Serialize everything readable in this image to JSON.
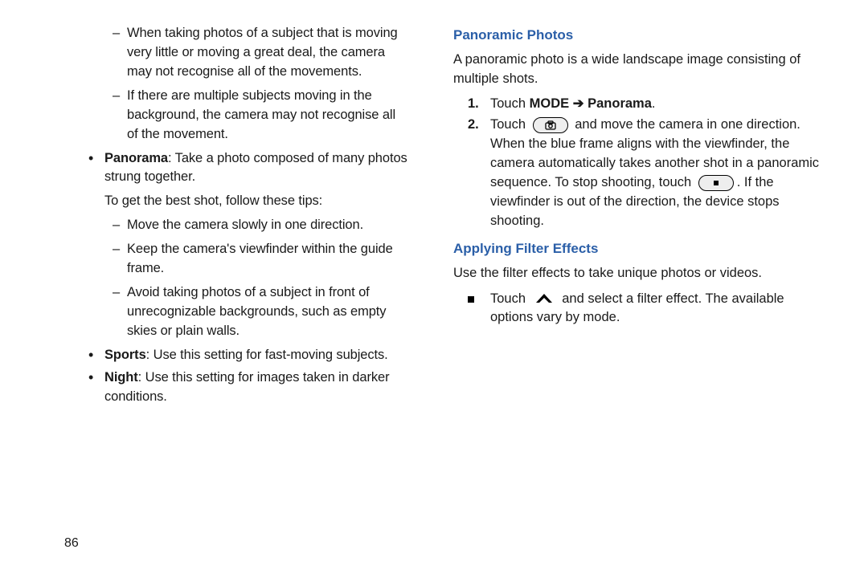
{
  "left": {
    "dash1": "When taking photos of a subject that is moving very little or moving a great deal, the camera may not recognise all of the movements.",
    "dash2": "If there are multiple subjects moving in the background, the camera may not recognise all of the movement.",
    "panorama_label": "Panorama",
    "panorama_text": ": Take a photo composed of many photos strung together.",
    "best_shot": "To get the best shot, follow these tips:",
    "tip1": "Move the camera slowly in one direction.",
    "tip2": "Keep the camera's viewfinder within the guide frame.",
    "tip3": "Avoid taking photos of a subject in front of unrecognizable backgrounds, such as empty skies or plain walls.",
    "sports_label": "Sports",
    "sports_text": ": Use this setting for fast-moving subjects.",
    "night_label": "Night",
    "night_text": ": Use this setting for images taken in darker conditions."
  },
  "right": {
    "panoramic_h": "Panoramic Photos",
    "panoramic_p": "A panoramic photo is a wide landscape image consisting of multiple shots.",
    "step1_num": "1.",
    "step1_a": "Touch ",
    "step1_b": "MODE ➔ Panorama",
    "step1_c": ".",
    "step2_num": "2.",
    "step2_a": "Touch ",
    "step2_b": " and move the camera in one direction. When the blue frame aligns with the viewfinder, the camera automatically takes another shot in a panoramic sequence. To stop shooting, touch ",
    "step2_c": ". If the viewfinder is out of the direction, the device stops shooting.",
    "filter_h": "Applying Filter Effects",
    "filter_p": "Use the filter effects to take unique photos or videos.",
    "filter_item_a": "Touch ",
    "filter_item_b": " and select a filter effect. The available options vary by mode."
  },
  "page_number": "86"
}
